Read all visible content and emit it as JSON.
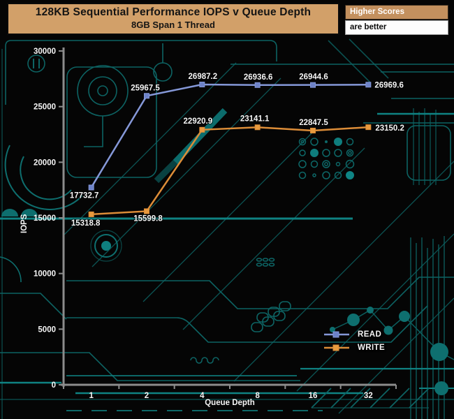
{
  "header": {
    "title": "128KB Sequential Performance IOPS v Queue Depth",
    "subtitle": "8GB Span 1 Thread"
  },
  "note": {
    "line1": "Higher Scores",
    "line2": "are better"
  },
  "chart_data": {
    "type": "line",
    "title": "128KB Sequential Performance IOPS v Queue Depth",
    "subtitle": "8GB Span 1 Thread",
    "categories": [
      "1",
      "2",
      "4",
      "8",
      "16",
      "32"
    ],
    "series": [
      {
        "name": "READ",
        "color": "#8598d8",
        "marker_color": "#6d82c8",
        "values": [
          17732.7,
          25967.5,
          26987.2,
          26936.6,
          26944.6,
          26969.6
        ]
      },
      {
        "name": "WRITE",
        "color": "#dd8d38",
        "marker_color": "#e89a3e",
        "values": [
          15318.8,
          15599.8,
          22920.9,
          23141.1,
          22847.5,
          23150.2
        ]
      }
    ],
    "xlabel": "Queue Depth",
    "ylabel": "IOPS",
    "ylim": [
      0,
      30000
    ],
    "yticks": [
      0,
      5000,
      10000,
      15000,
      20000,
      25000,
      30000
    ],
    "grid": false,
    "legend_position": "bottom-right"
  },
  "colors": {
    "background": "#050505",
    "circuit_dim": "#0d6363",
    "circuit_bright": "#0f8282",
    "axis": "#8c8c8c",
    "header_bg": "#d2a069",
    "note_bg": "#c3905e",
    "label_text": "#f5f5f5"
  }
}
